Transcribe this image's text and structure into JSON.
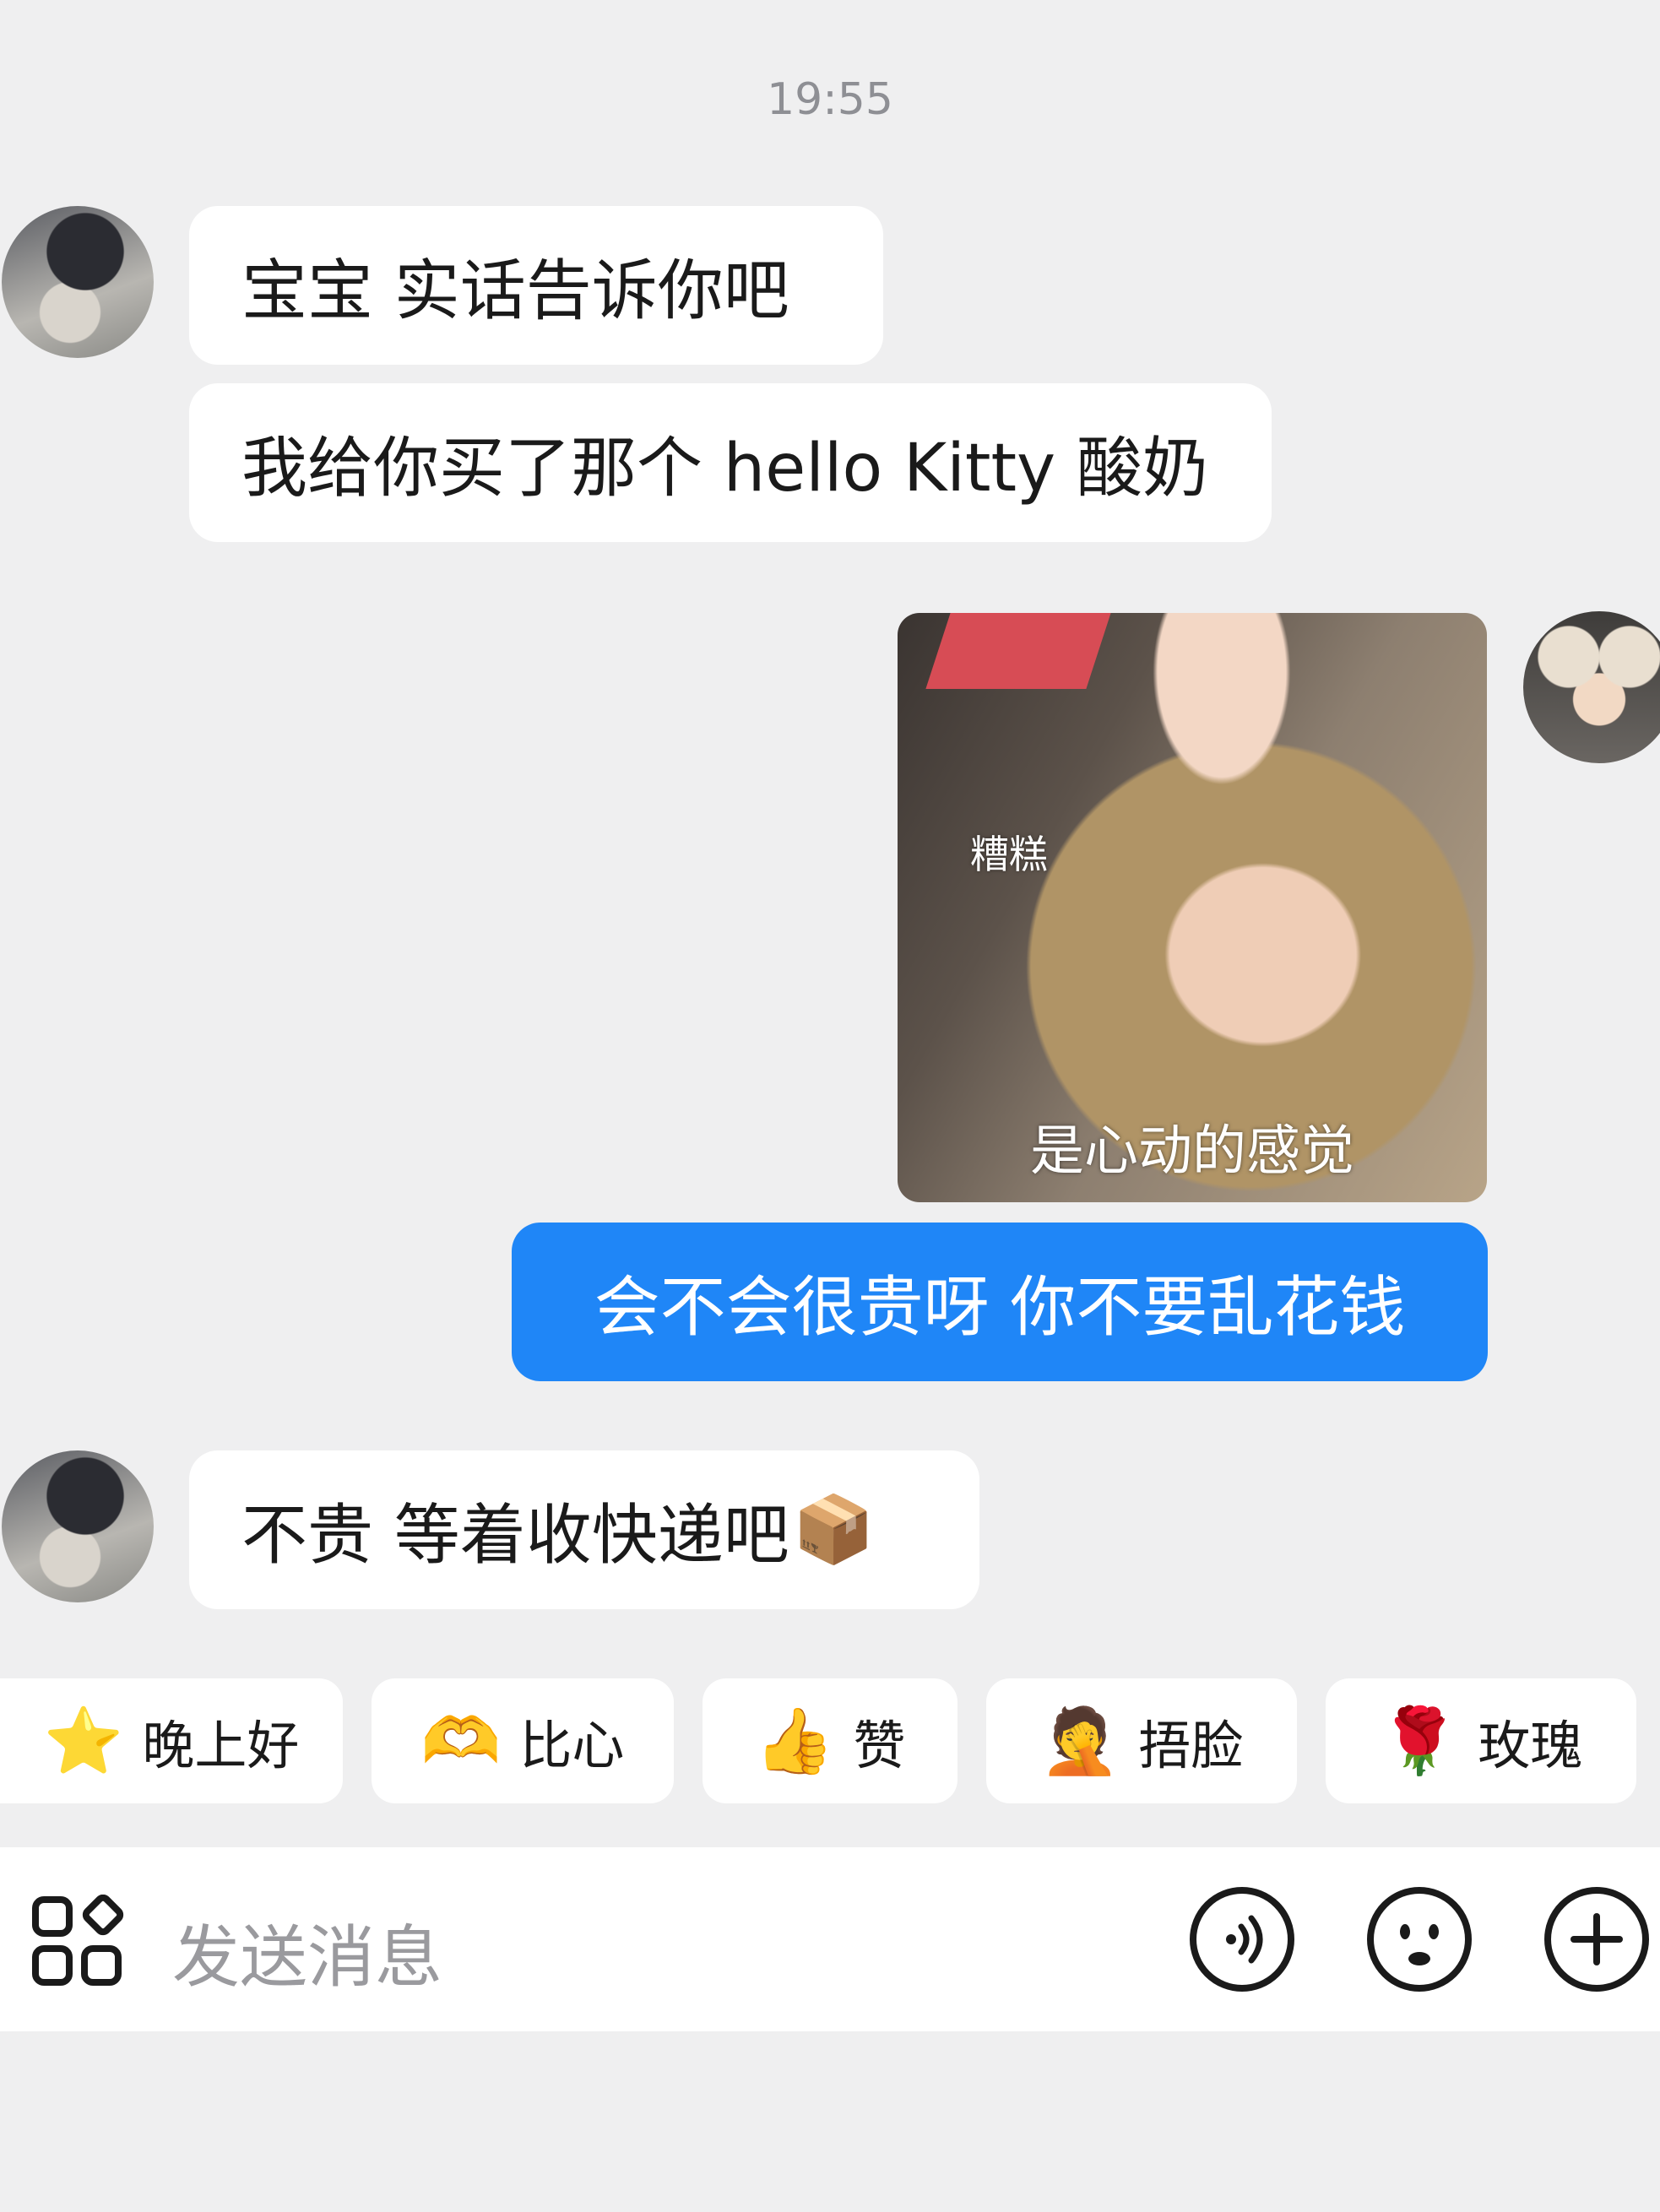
{
  "timestamp": "19:55",
  "messages": [
    {
      "sender": "other",
      "text": "宝宝 实话告诉你吧"
    },
    {
      "sender": "other",
      "text": "我给你买了那个 hello Kitty 酸奶"
    },
    {
      "sender": "me",
      "type": "sticker",
      "caption_top": "糟糕",
      "caption_bottom": "是心动的感觉"
    },
    {
      "sender": "me",
      "text": "会不会很贵呀 你不要乱花钱"
    },
    {
      "sender": "other",
      "text": "不贵 等着收快递吧",
      "emoji": "📦"
    }
  ],
  "quick_replies": [
    {
      "label": "晚上好",
      "icon": "⭐",
      "icon_name": "star-face-icon"
    },
    {
      "label": "比心",
      "icon": "🫶",
      "icon_name": "finger-heart-icon"
    },
    {
      "label": "赞",
      "icon": "👍",
      "icon_name": "thumbs-up-icon"
    },
    {
      "label": "捂脸",
      "icon": "🤦",
      "icon_name": "facepalm-icon"
    },
    {
      "label": "玫瑰",
      "icon": "🌹",
      "icon_name": "rose-icon"
    }
  ],
  "input": {
    "placeholder": "发送消息"
  },
  "colors": {
    "background": "#efeff0",
    "bubble_other": "#ffffff",
    "bubble_me": "#1f86f7",
    "timestamp": "#8e8f94",
    "placeholder": "#9a9a9e"
  }
}
